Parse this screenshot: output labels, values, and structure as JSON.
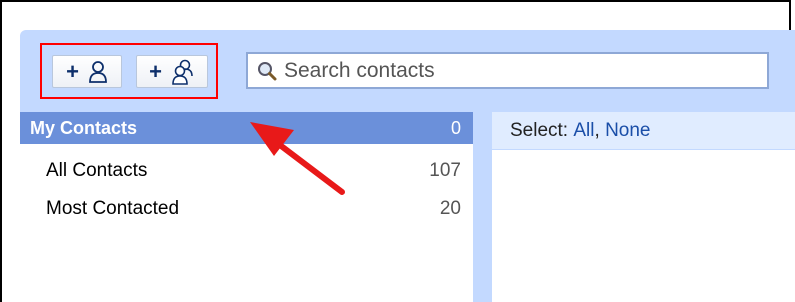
{
  "toolbar": {
    "add_contact_button": {
      "label": "+",
      "icon": "person-icon"
    },
    "add_group_button": {
      "label": "+",
      "icon": "group-icon"
    },
    "search": {
      "placeholder": "Search contacts",
      "icon": "search-icon"
    }
  },
  "sidebar": {
    "header": {
      "label": "My Contacts",
      "count": "0"
    },
    "items": [
      {
        "label": "All Contacts",
        "count": "107"
      },
      {
        "label": "Most Contacted",
        "count": "20"
      }
    ]
  },
  "main": {
    "select_label": "Select:",
    "select_all": "All",
    "select_separator": ",",
    "select_none": "None"
  },
  "colors": {
    "app_background": "#c3d9ff",
    "header_selected": "#6b90da",
    "highlight_box": "#ff0000",
    "annotation_arrow": "#ff0000"
  }
}
